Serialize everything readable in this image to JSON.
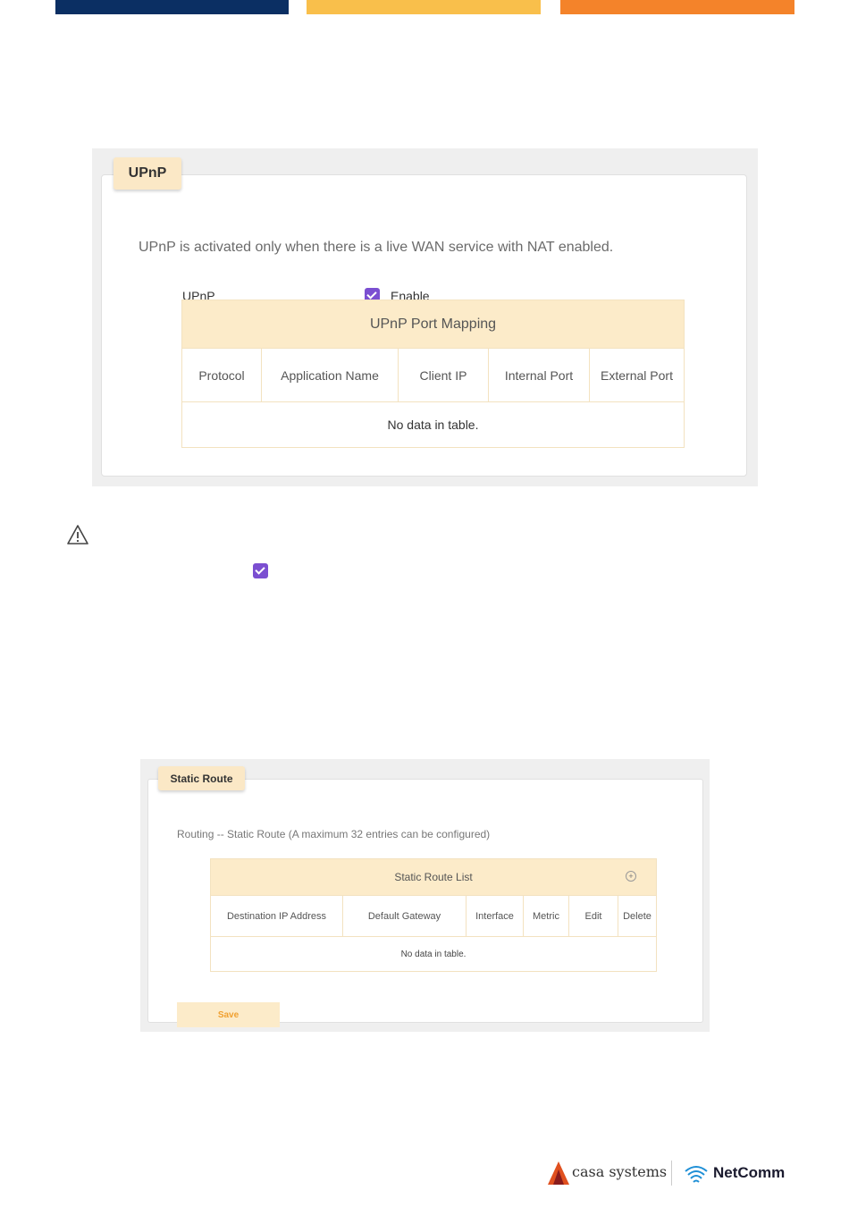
{
  "colors": {
    "bar1": "#0b2f63",
    "bar2": "#f9bf4b",
    "bar3": "#f4832a",
    "accent": "#7b4fd1",
    "table_header": "#fcebc9"
  },
  "upnp": {
    "tab": "UPnP",
    "note": "UPnP is activated only when there is a live WAN service with NAT enabled.",
    "field_label": "UPnP",
    "enable_label": "Enable",
    "enable_checked": true,
    "table": {
      "title": "UPnP Port Mapping",
      "columns": [
        "Protocol",
        "Application Name",
        "Client IP",
        "Internal Port",
        "External Port"
      ],
      "empty": "No data in table."
    }
  },
  "warning_icon": "warning-triangle-icon",
  "static_route": {
    "tab": "Static Route",
    "note": "Routing -- Static Route (A maximum 32 entries can be configured)",
    "table": {
      "title": "Static Route List",
      "columns": [
        "Destination IP Address",
        "Default Gateway",
        "Interface",
        "Metric",
        "Edit",
        "Delete"
      ],
      "empty": "No data in table."
    },
    "save_label": "Save"
  },
  "logos": {
    "casa": "casa systems",
    "netcomm": "NetComm"
  }
}
